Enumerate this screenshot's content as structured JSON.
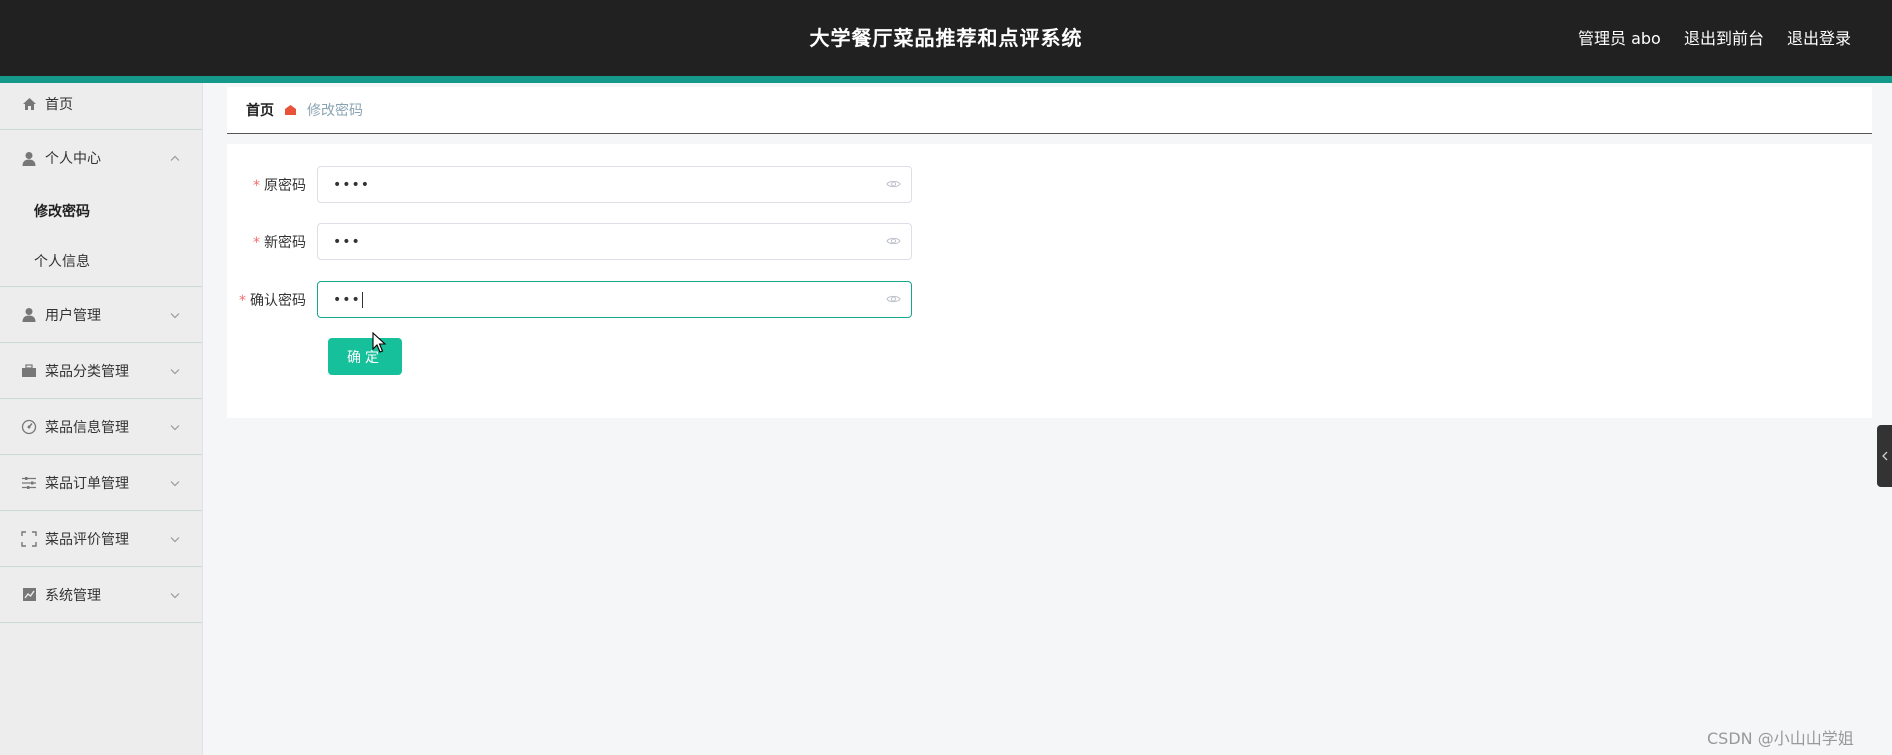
{
  "header": {
    "title": "大学餐厅菜品推荐和点评系统",
    "user_label": "管理员 abo",
    "front_label": "退出到前台",
    "logout_label": "退出登录"
  },
  "sidebar": {
    "home": "首页",
    "personal_center": "个人中心",
    "personal_sub": [
      "修改密码",
      "个人信息"
    ],
    "items": [
      "用户管理",
      "菜品分类管理",
      "菜品信息管理",
      "菜品订单管理",
      "菜品评价管理",
      "系统管理"
    ]
  },
  "breadcrumb": {
    "home": "首页",
    "current": "修改密码"
  },
  "form": {
    "required_mark": "*",
    "old_password_label": "原密码",
    "old_password_value": "••••",
    "new_password_label": "新密码",
    "new_password_value": "•••",
    "confirm_password_label": "确认密码",
    "confirm_password_value": "•••",
    "submit_label": "确定"
  },
  "watermark": "CSDN @小山山学姐",
  "colors": {
    "header_bg": "#212121",
    "accent_strip": "#15998a",
    "button": "#16c09b",
    "focus_border": "#15a88f"
  }
}
